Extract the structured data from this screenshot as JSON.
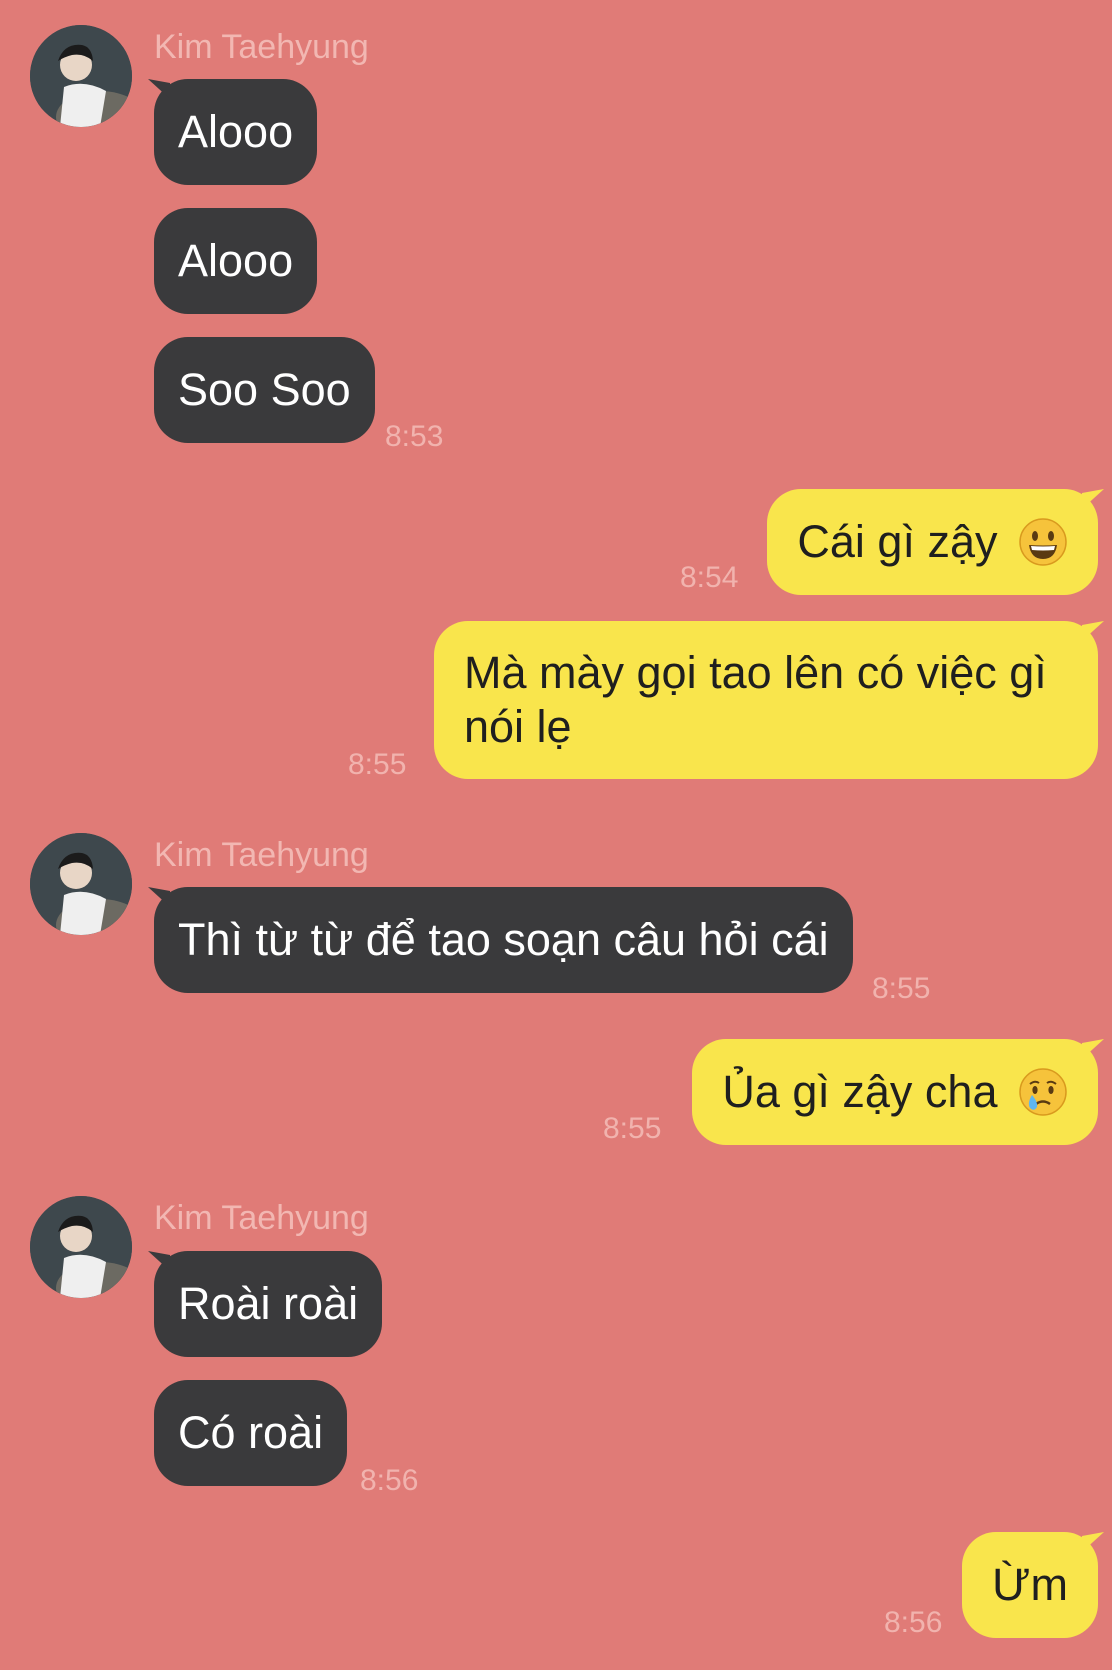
{
  "chat": {
    "contact_name": "Kim Taehyung",
    "messages": [
      {
        "sender": "Kim Taehyung",
        "text": "Alooo"
      },
      {
        "sender": "Kim Taehyung",
        "text": "Alooo"
      },
      {
        "sender": "Kim Taehyung",
        "text": "Soo Soo",
        "time": "8:53"
      },
      {
        "sender": "me",
        "text": "Cái gì zậy",
        "emoji": "grinning-face-emoji",
        "time": "8:54"
      },
      {
        "sender": "me",
        "text": "Mà mày gọi tao lên có việc gì nói lẹ",
        "time": "8:55"
      },
      {
        "sender": "Kim Taehyung",
        "text": "Thì từ từ để tao soạn câu hỏi cái",
        "time": "8:55"
      },
      {
        "sender": "me",
        "text": "Ủa gì zậy cha",
        "emoji": "crying-face-emoji",
        "time": "8:55"
      },
      {
        "sender": "Kim Taehyung",
        "text": "Roài roài"
      },
      {
        "sender": "Kim Taehyung",
        "text": "Có roài",
        "time": "8:56"
      },
      {
        "sender": "me",
        "text": "Ừm",
        "time": "8:56"
      }
    ]
  },
  "colors": {
    "background": "#e07b77",
    "incoming_bubble": "#3a3a3c",
    "outgoing_bubble": "#f9e54c",
    "timestamp": "#f1b3ae"
  }
}
